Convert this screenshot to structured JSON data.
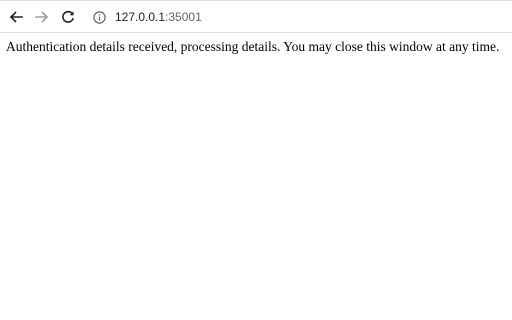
{
  "browser": {
    "back_icon": "arrow-left-icon",
    "forward_icon": "arrow-right-icon",
    "reload_icon": "reload-icon",
    "site_info_icon": "info-circle-icon",
    "url_host": "127.0.0.1",
    "url_port": ":35001",
    "colors": {
      "icon_active": "#202124",
      "icon_disabled": "#9aa0a6",
      "border": "#dadce0"
    }
  },
  "page": {
    "message": "Authentication details received, processing details. You may close this window at any time."
  }
}
